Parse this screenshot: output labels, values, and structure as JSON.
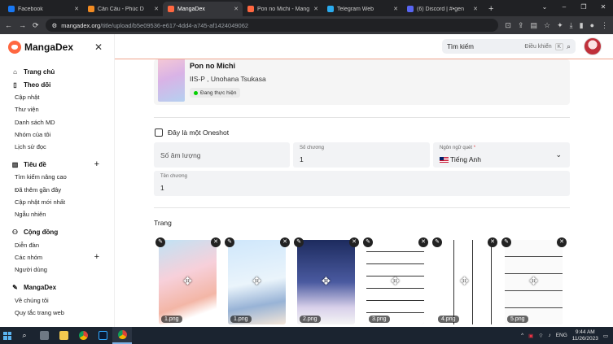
{
  "browser": {
    "tabs": [
      {
        "label": "Facebook",
        "color": "#1877f2",
        "active": false
      },
      {
        "label": "Cẩn Cẩu - Phúc D",
        "color": "#f28b22",
        "active": false
      },
      {
        "label": "MangaDex",
        "color": "#ff6740",
        "active": true
      },
      {
        "label": "Pon no Michi - Mang",
        "color": "#ff6740",
        "active": false
      },
      {
        "label": "Telegram Web",
        "color": "#2aabee",
        "active": false
      },
      {
        "label": "(6) Discord | #•gen",
        "color": "#5865f2",
        "active": false
      }
    ],
    "url_host": "mangadex.org",
    "url_path": "/title/upload/b5e09536-e617-4dd4-a745-af1424049062"
  },
  "sidebar": {
    "brand": "MangaDex",
    "home": "Trang chủ",
    "follows": "Theo dõi",
    "follows_items": [
      "Cập nhật",
      "Thư viện",
      "Danh sách MD",
      "Nhóm của tôi",
      "Lịch sử đọc"
    ],
    "titles": "Tiêu đề",
    "titles_items": [
      "Tìm kiếm nâng cao",
      "Đã thêm gần đây",
      "Cập nhật mới nhất",
      "Ngẫu nhiên"
    ],
    "community": "Cộng đồng",
    "community_items": [
      "Diễn đàn",
      "Các nhóm",
      "Người dùng"
    ],
    "mangadex": "MangaDex",
    "mangadex_items": [
      "Về chúng tôi",
      "Quy tắc trang web"
    ]
  },
  "topbar": {
    "search_placeholder": "Tìm kiếm",
    "search_hint": "Điều khiển",
    "search_key": "K"
  },
  "manga": {
    "title": "Pon no Michi",
    "authors": "IIS-P , Unohana Tsukasa",
    "status": "Đang thực hiện"
  },
  "form": {
    "oneshot_label": "Đây là một Oneshot",
    "volume_placeholder": "Số âm lượng",
    "chapter_label": "Số chương",
    "chapter_value": "1",
    "language_label": "Ngôn ngữ quét",
    "language_required": "*",
    "language_value": "Tiếng Anh",
    "chapter_title_label": "Tên chương",
    "chapter_title_value": "1",
    "pages_heading": "Trang"
  },
  "pages": [
    "1.png",
    "1.png",
    "2.png",
    "3.png",
    "4.png",
    "5.png"
  ],
  "taskbar": {
    "lang": "ENG",
    "time": "9:44 AM",
    "date": "11/26/2023"
  },
  "colors": {
    "accent": "#ff6740",
    "status_green": "#04d000"
  }
}
